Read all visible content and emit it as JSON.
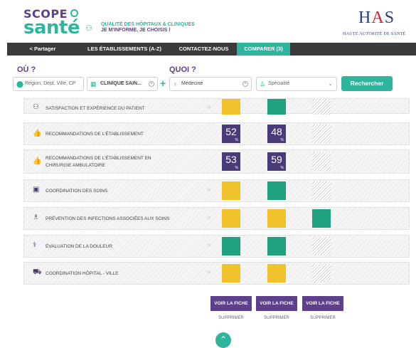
{
  "header": {
    "logo_scope": "SCOPE",
    "logo_sante": "santé",
    "tagline_line1": "QUALITÉ DES HÔPITAUX & CLINIQUES",
    "tagline_line2": "JE M'INFORME, JE CHOISIS !",
    "has_logo": "HAS",
    "has_subtitle": "HAUTE AUTORITÉ DE SANTÉ"
  },
  "nav": {
    "items": [
      {
        "label": "< Partager"
      },
      {
        "label": "LES ÉTABLISSEMENTS (A-Z)"
      },
      {
        "label": "CONTACTEZ-NOUS"
      },
      {
        "label": "COMPARER (3)"
      }
    ]
  },
  "search": {
    "ou_label": "OÙ ?",
    "quoi_label": "QUOI ?",
    "location_placeholder": "Région, Dept, Ville, CP",
    "establishment_value": "CLINIQUE SAIN...",
    "activity_value": "Médecine",
    "specialty_placeholder": "Spécialité",
    "button_label": "Rechercher"
  },
  "rows": [
    {
      "label": "SATISFACTION ET EXPÉRIENCE DU PATIENT"
    },
    {
      "label": "RECOMMANDATIONS DE L'ÉTABLISSEMENT",
      "scores": [
        "52",
        "48"
      ],
      "pct": "%"
    },
    {
      "label_line1": "RECOMMANDATIONS DE L'ÉTABLISSEMENT EN",
      "label_line2": "CHIRURGIE AMBULATOIRE",
      "scores": [
        "53",
        "59"
      ],
      "pct": "%"
    },
    {
      "label": "COORDINATION DES SOINS"
    },
    {
      "label": "PRÉVENTION DES INFECTIONS ASSOCIÉES AUX SOINS"
    },
    {
      "label": "ÉVALUATION DE LA DOULEUR"
    },
    {
      "label": "COORDINATION HÔPITAL - VILLE"
    }
  ],
  "colors": {
    "accent": "#2fb59d",
    "brand_purple": "#5d3f8c",
    "yellow": "#f0c22b",
    "green": "#1fa07f"
  },
  "actions": {
    "voir_fiche": "VOIR LA FICHE",
    "supprimer": "SUPPRIMER"
  }
}
